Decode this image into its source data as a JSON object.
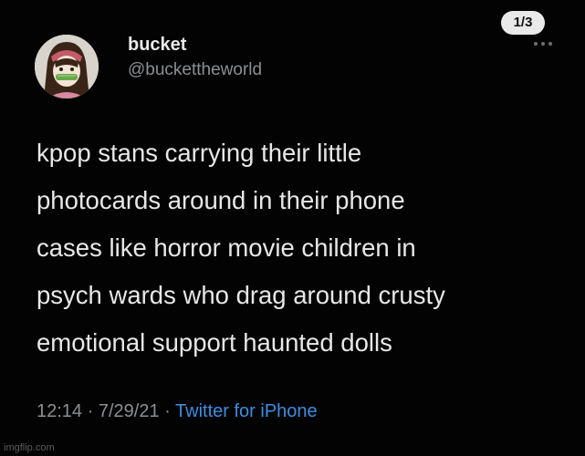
{
  "page_badge": "1/3",
  "author": {
    "display_name": "bucket",
    "handle": "@buckettheworld"
  },
  "tweet": {
    "lines": [
      "kpop stans carrying their little",
      "photocards around in their phone",
      "cases like horror movie children in",
      "psych wards who drag around crusty",
      "emotional support haunted dolls"
    ],
    "time": "12:14",
    "separator": "·",
    "date": "7/29/21",
    "source": "Twitter for iPhone"
  },
  "icons": {
    "more": "more-horizontal-icon"
  },
  "watermark": "imgflip.com",
  "colors": {
    "background": "#030303",
    "text": "#e7e7e7",
    "secondary_text": "#8b8f93",
    "link": "#3e8de0",
    "badge_bg": "#e9e9e9"
  }
}
